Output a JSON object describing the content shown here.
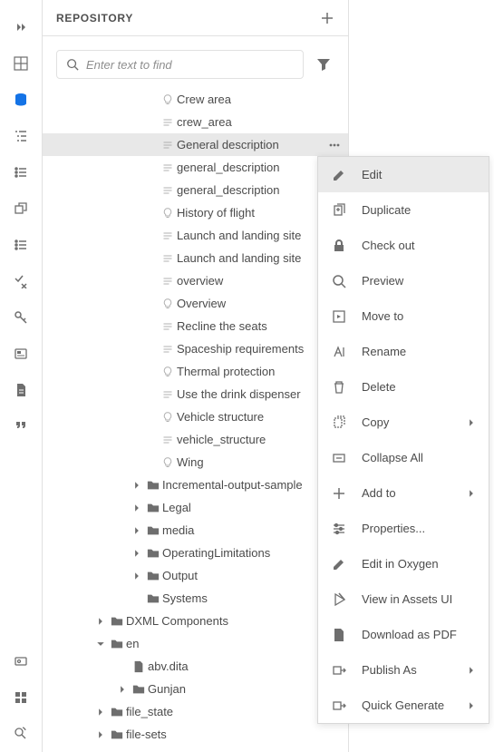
{
  "panel": {
    "title": "REPOSITORY",
    "search_placeholder": "Enter text to find"
  },
  "tree": {
    "topics": [
      {
        "label": "Crew area",
        "icon": "bulb"
      },
      {
        "label": "crew_area",
        "icon": "topic"
      },
      {
        "label": "General description",
        "icon": "topic",
        "selected": true
      },
      {
        "label": "general_description",
        "icon": "topic"
      },
      {
        "label": "general_description",
        "icon": "topic"
      },
      {
        "label": "History of flight",
        "icon": "bulb"
      },
      {
        "label": "Launch and landing site",
        "icon": "topic"
      },
      {
        "label": "Launch and landing site",
        "icon": "topic"
      },
      {
        "label": "overview",
        "icon": "topic"
      },
      {
        "label": "Overview",
        "icon": "bulb"
      },
      {
        "label": "Recline the seats",
        "icon": "topic"
      },
      {
        "label": "Spaceship requirements",
        "icon": "topic"
      },
      {
        "label": "Thermal protection",
        "icon": "bulb"
      },
      {
        "label": "Use the drink dispenser",
        "icon": "topic"
      },
      {
        "label": "Vehicle structure",
        "icon": "bulb"
      },
      {
        "label": "vehicle_structure",
        "icon": "topic"
      },
      {
        "label": "Wing",
        "icon": "bulb"
      }
    ],
    "folders_a": [
      {
        "label": "Incremental-output-sample"
      },
      {
        "label": "Legal"
      },
      {
        "label": "media"
      },
      {
        "label": "OperatingLimitations"
      },
      {
        "label": "Output"
      },
      {
        "label": "Systems"
      }
    ],
    "dxml": {
      "label": "DXML Components"
    },
    "en": {
      "label": "en"
    },
    "abv": {
      "label": "abv.dita"
    },
    "gunjan": {
      "label": "Gunjan"
    },
    "file_state": {
      "label": "file_state"
    },
    "file_sets": {
      "label": "file-sets"
    }
  },
  "menu": {
    "items": [
      {
        "label": "Edit",
        "icon": "edit",
        "highlight": true
      },
      {
        "label": "Duplicate",
        "icon": "duplicate"
      },
      {
        "label": "Check out",
        "icon": "lock"
      },
      {
        "label": "Preview",
        "icon": "preview"
      },
      {
        "label": "Move to",
        "icon": "move"
      },
      {
        "label": "Rename",
        "icon": "rename"
      },
      {
        "label": "Delete",
        "icon": "delete"
      },
      {
        "label": "Copy",
        "icon": "copy",
        "arrow": true
      },
      {
        "label": "Collapse All",
        "icon": "collapse"
      },
      {
        "label": "Add to",
        "icon": "add",
        "arrow": true
      },
      {
        "label": "Properties...",
        "icon": "properties"
      },
      {
        "label": "Edit in Oxygen",
        "icon": "oxygen"
      },
      {
        "label": "View in Assets UI",
        "icon": "external"
      },
      {
        "label": "Download as PDF",
        "icon": "pdf"
      },
      {
        "label": "Publish As",
        "icon": "publish",
        "arrow": true
      },
      {
        "label": "Quick Generate",
        "icon": "generate",
        "arrow": true
      }
    ]
  }
}
